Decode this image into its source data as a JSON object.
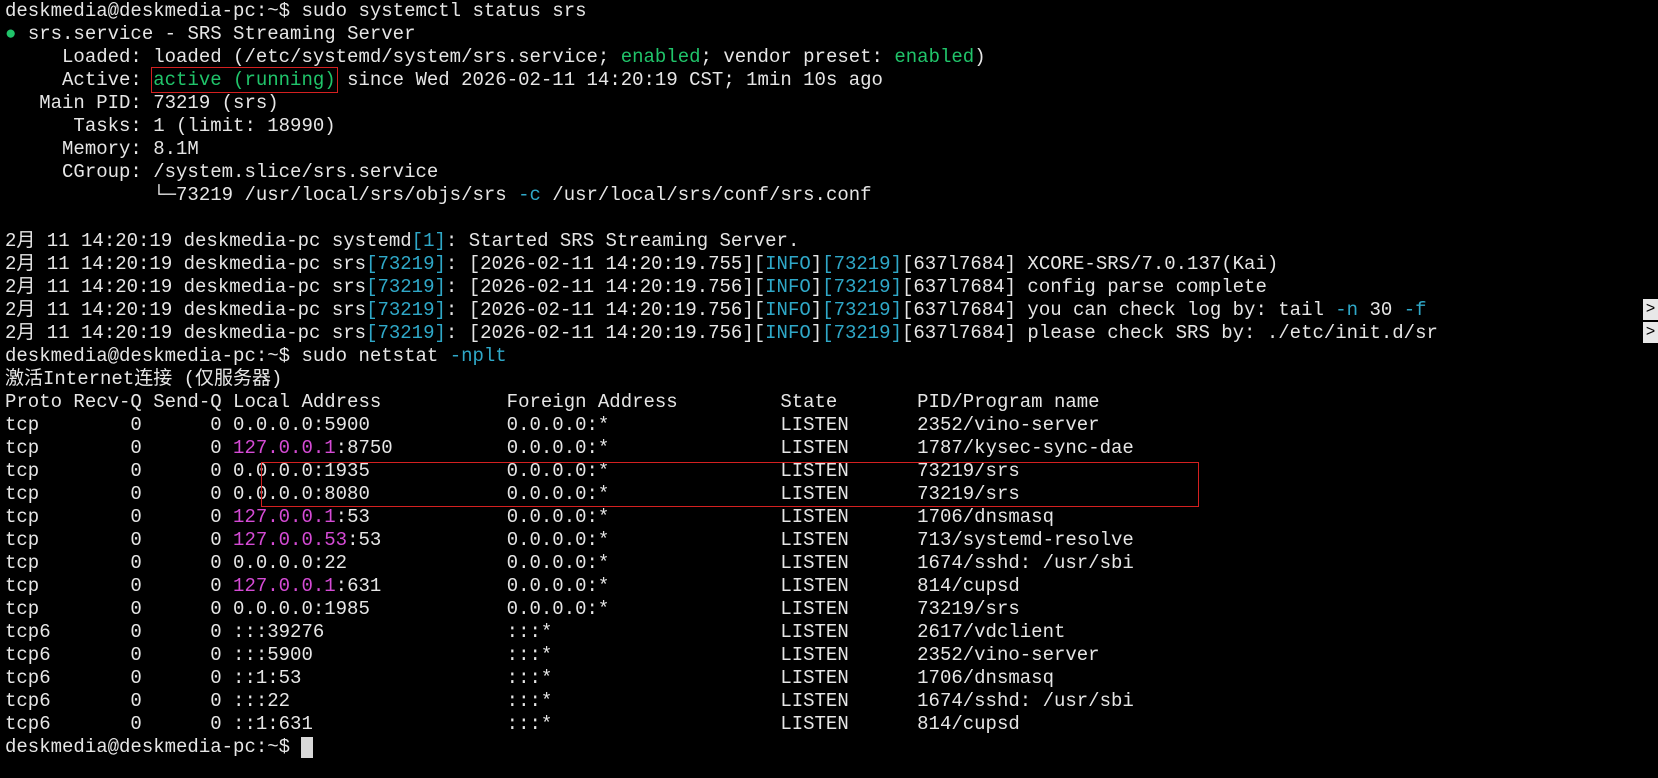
{
  "terminal": {
    "lines": [
      [
        {
          "t": "deskmedia@deskmedia-pc:~$ sudo systemctl status srs"
        }
      ],
      [
        {
          "t": "● ",
          "cls": "dot"
        },
        {
          "t": "srs.service - SRS Streaming Server"
        }
      ],
      [
        {
          "t": "     Loaded: loaded (/etc/systemd/system/srs.service; "
        },
        {
          "t": "enabled",
          "cls": "g"
        },
        {
          "t": "; vendor preset: "
        },
        {
          "t": "enabled",
          "cls": "g"
        },
        {
          "t": ")"
        }
      ],
      [
        {
          "t": "     Active: "
        },
        {
          "t": "active (running)",
          "cls": "g hl-box"
        },
        {
          "t": " since Wed 2026-02-11 14:20:19 CST; 1min 10s ago"
        }
      ],
      [
        {
          "t": "   Main PID: 73219 (srs)"
        }
      ],
      [
        {
          "t": "      Tasks: 1 (limit: 18990)"
        }
      ],
      [
        {
          "t": "     Memory: 8.1M"
        }
      ],
      [
        {
          "t": "     CGroup: /system.slice/srs.service"
        }
      ],
      [
        {
          "t": "             └─73219 /usr/local/srs/objs/srs "
        },
        {
          "t": "-c",
          "cls": "c"
        },
        {
          "t": " /usr/local/srs/conf/srs.conf"
        }
      ],
      [
        {
          "t": ""
        }
      ],
      [
        {
          "t": "2月 11 14:20:19 deskmedia-pc systemd"
        },
        {
          "t": "[1]",
          "cls": "c"
        },
        {
          "t": ": Started SRS Streaming Server."
        }
      ],
      [
        {
          "t": "2月 11 14:20:19 deskmedia-pc srs"
        },
        {
          "t": "[73219]",
          "cls": "c"
        },
        {
          "t": ": [2026-02-11 14:20:19.755]["
        },
        {
          "t": "INFO",
          "cls": "c"
        },
        {
          "t": "]"
        },
        {
          "t": "[73219]",
          "cls": "c"
        },
        {
          "t": "[637l7684] XCORE-SRS/7.0.137(Kai)"
        }
      ],
      [
        {
          "t": "2月 11 14:20:19 deskmedia-pc srs"
        },
        {
          "t": "[73219]",
          "cls": "c"
        },
        {
          "t": ": [2026-02-11 14:20:19.756]["
        },
        {
          "t": "INFO",
          "cls": "c"
        },
        {
          "t": "]"
        },
        {
          "t": "[73219]",
          "cls": "c"
        },
        {
          "t": "[637l7684] config parse complete"
        }
      ],
      [
        {
          "t": "2月 11 14:20:19 deskmedia-pc srs"
        },
        {
          "t": "[73219]",
          "cls": "c"
        },
        {
          "t": ": [2026-02-11 14:20:19.756]["
        },
        {
          "t": "INFO",
          "cls": "c"
        },
        {
          "t": "]"
        },
        {
          "t": "[73219]",
          "cls": "c"
        },
        {
          "t": "[637l7684] you can check log by: tail "
        },
        {
          "t": "-n",
          "cls": "c"
        },
        {
          "t": " 30 "
        },
        {
          "t": "-f",
          "cls": "c"
        }
      ],
      [
        {
          "t": "2月 11 14:20:19 deskmedia-pc srs"
        },
        {
          "t": "[73219]",
          "cls": "c"
        },
        {
          "t": ": [2026-02-11 14:20:19.756]["
        },
        {
          "t": "INFO",
          "cls": "c"
        },
        {
          "t": "]"
        },
        {
          "t": "[73219]",
          "cls": "c"
        },
        {
          "t": "[637l7684] please check SRS by: ./etc/init.d/sr"
        }
      ],
      [
        {
          "t": "deskmedia@deskmedia-pc:~$ sudo netstat "
        },
        {
          "t": "-nplt",
          "cls": "c"
        }
      ],
      [
        {
          "t": "激活Internet连接 (仅服务器)"
        }
      ],
      [
        {
          "t": "Proto Recv-Q Send-Q Local Address           Foreign Address         State       PID/Program name"
        }
      ],
      [
        {
          "t": "tcp        0      0 0.0.0.0:5900            0.0.0.0:*               LISTEN      2352/vino-server"
        }
      ],
      [
        {
          "t": "tcp        0      0 "
        },
        {
          "t": "127.0.0.1",
          "cls": "m"
        },
        {
          "t": ":8750          0.0.0.0:*               LISTEN      1787/kysec-sync-dae"
        }
      ],
      [
        {
          "t": "tcp        0      0 0.0.0.0:1935            0.0.0.0:*               LISTEN      73219/srs"
        }
      ],
      [
        {
          "t": "tcp        0      0 0.0.0.0:8080            0.0.0.0:*               LISTEN      73219/srs"
        }
      ],
      [
        {
          "t": "tcp        0      0 "
        },
        {
          "t": "127.0.0.1",
          "cls": "m"
        },
        {
          "t": ":53            0.0.0.0:*               LISTEN      1706/dnsmasq"
        }
      ],
      [
        {
          "t": "tcp        0      0 "
        },
        {
          "t": "127.0.0.53",
          "cls": "m"
        },
        {
          "t": ":53           0.0.0.0:*               LISTEN      713/systemd-resolve"
        }
      ],
      [
        {
          "t": "tcp        0      0 0.0.0.0:22              0.0.0.0:*               LISTEN      1674/sshd: /usr/sbi"
        }
      ],
      [
        {
          "t": "tcp        0      0 "
        },
        {
          "t": "127.0.0.1",
          "cls": "m"
        },
        {
          "t": ":631           0.0.0.0:*               LISTEN      814/cupsd"
        }
      ],
      [
        {
          "t": "tcp        0      0 0.0.0.0:1985            0.0.0.0:*               LISTEN      73219/srs"
        }
      ],
      [
        {
          "t": "tcp6       0      0 :::39276                :::*                    LISTEN      2617/vdclient"
        }
      ],
      [
        {
          "t": "tcp6       0      0 :::5900                 :::*                    LISTEN      2352/vino-server"
        }
      ],
      [
        {
          "t": "tcp6       0      0 ::1:53                  :::*                    LISTEN      1706/dnsmasq"
        }
      ],
      [
        {
          "t": "tcp6       0      0 :::22                   :::*                    LISTEN      1674/sshd: /usr/sbi"
        }
      ],
      [
        {
          "t": "tcp6       0      0 ::1:631                 :::*                    LISTEN      814/cupsd"
        }
      ],
      [
        {
          "t": "deskmedia@deskmedia-pc:~$ "
        }
      ]
    ],
    "truncation_marker": ">",
    "truncated_lines": [
      13,
      14
    ],
    "cursor_line": 32
  }
}
